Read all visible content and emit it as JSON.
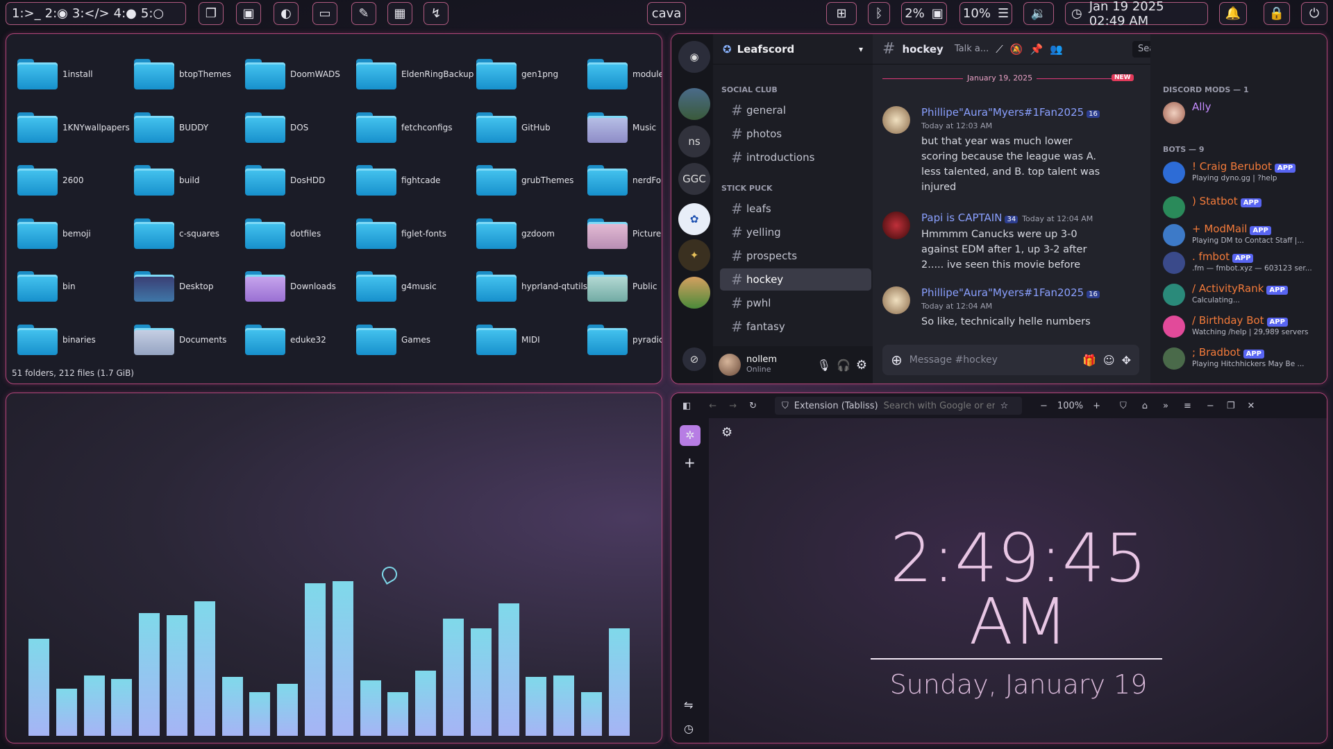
{
  "topbar": {
    "workspaces": [
      {
        "num": "1:"
      },
      {
        "num": "2:"
      },
      {
        "num": "3:"
      },
      {
        "num": "4:"
      },
      {
        "num": "5:"
      }
    ],
    "active_app": "cava",
    "cpu": "2%",
    "mem": "10%",
    "datetime": "Jan 19 2025 02:49 AM"
  },
  "filemanager": {
    "folders": [
      "1install",
      "btopThemes",
      "DoomWADS",
      "EldenRingBackup",
      "gen1png",
      "module",
      "1KNYwallpapers",
      "BUDDY",
      "DOS",
      "fetchconfigs",
      "GitHub",
      "Music",
      "2600",
      "build",
      "DosHDD",
      "fightcade",
      "grubThemes",
      "nerdFo",
      "bemoji",
      "c-squares",
      "dotfiles",
      "figlet-fonts",
      "gzdoom",
      "Picture",
      "bin",
      "Desktop",
      "Downloads",
      "g4music",
      "hyprland-qtutils",
      "Public",
      "binaries",
      "Documents",
      "eduke32",
      "Games",
      "MIDI",
      "pyradic"
    ],
    "status": "51 folders, 212 files (1.7 GiB)"
  },
  "cava": {
    "values": [
      0.58,
      0.28,
      0.36,
      0.34,
      0.73,
      0.72,
      0.8,
      0.35,
      0.26,
      0.31,
      0.91,
      0.92,
      0.33,
      0.26,
      0.39,
      0.7,
      0.64,
      0.79,
      0.35,
      0.36,
      0.26,
      0.64
    ]
  },
  "discord": {
    "server_name": "Leafscord",
    "servers": [
      "ns",
      "GGC"
    ],
    "categories": [
      "SOCIAL CLUB",
      "STICK PUCK"
    ],
    "channels_social": [
      "general",
      "photos",
      "introductions"
    ],
    "channels_stick": [
      "leafs",
      "yelling",
      "prospects",
      "hockey",
      "pwhl",
      "fantasy"
    ],
    "user": {
      "name": "nollem",
      "status": "Online"
    },
    "channel_title": "hockey",
    "topic": "Talk a...",
    "search_placeholder": "Search",
    "date_divider": "January 19, 2025",
    "new_label": "NEW",
    "messages": [
      {
        "author": "Phillipe\"Aura\"Myers#1Fan2025",
        "tag": "16",
        "time": "Today at 12:03 AM",
        "text": "but that year was much lower scoring because the league was A. less talented, and B. top talent was injured"
      },
      {
        "author": "Papi is CAPTAIN",
        "tag": "34",
        "time": "Today at 12:04 AM",
        "text": "Hmmmm Canucks were up 3-0 against EDM after 1, up 3-2 after 2..... ive seen this movie before"
      },
      {
        "author": "Phillipe\"Aura\"Myers#1Fan2025",
        "tag": "16",
        "time": "Today at 12:04 AM",
        "text": "So like, technically helle numbers are"
      }
    ],
    "input_placeholder": "Message #hockey",
    "member_groups": {
      "mods": "DISCORD MODS — 1",
      "bots": "BOTS — 9"
    },
    "mods": [
      {
        "name": "Ally"
      }
    ],
    "bots": [
      {
        "name": "! Craig Berubot",
        "status": "Playing dyno.gg | ?help",
        "color": "#f47b3a"
      },
      {
        "name": ") Statbot",
        "status": "",
        "color": "#f47b3a"
      },
      {
        "name": "+ ModMail",
        "status": "Playing DM to Contact Staff |...",
        "color": "#f47b3a"
      },
      {
        "name": ". fmbot",
        "status": ".fm — fmbot.xyz — 603123 ser...",
        "color": "#f47b3a"
      },
      {
        "name": "/ ActivityRank",
        "status": "Calculating...",
        "color": "#f47b3a"
      },
      {
        "name": "/ Birthday Bot",
        "status": "Watching /help | 29,989 servers",
        "color": "#f47b3a"
      },
      {
        "name": "; Bradbot",
        "status": "Playing Hitchhickers May Be ...",
        "color": "#f47b3a"
      }
    ],
    "app_label": "APP"
  },
  "browser": {
    "extension": "Extension (Tabliss)",
    "url_placeholder": "Search with Google or er",
    "zoom": "100%",
    "time": "2:49:45",
    "ampm": "AM",
    "date": "Sunday, January 19"
  }
}
